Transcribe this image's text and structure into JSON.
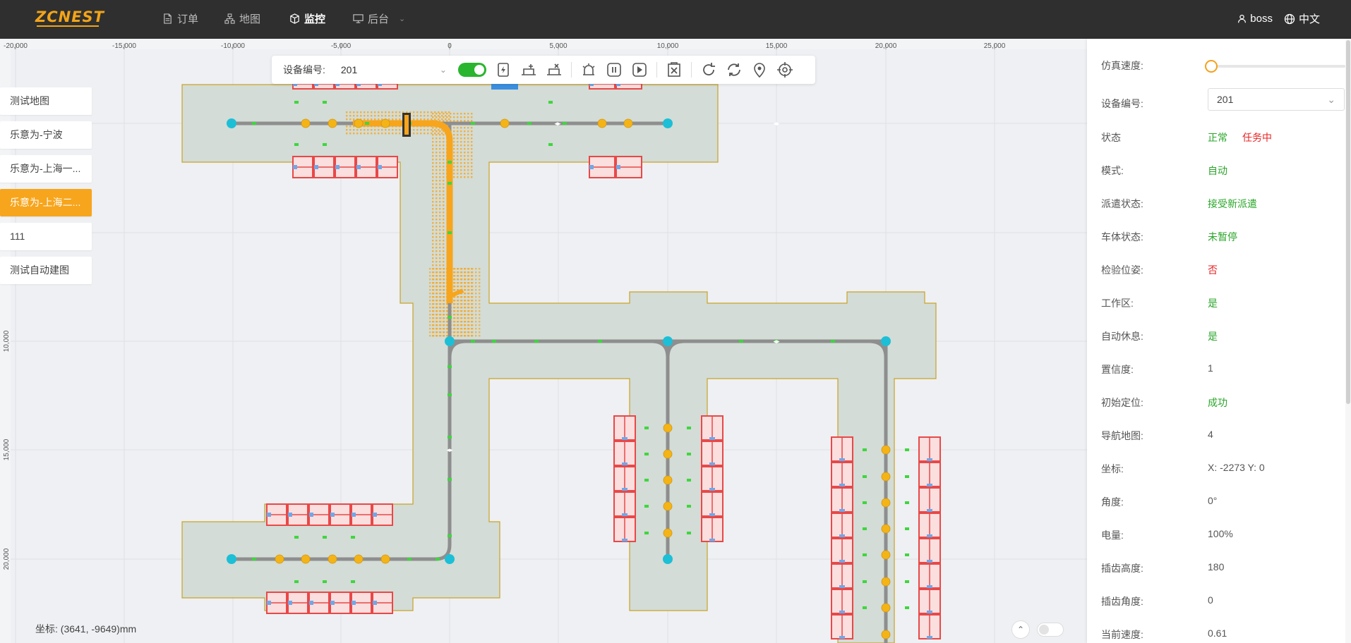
{
  "header": {
    "logo": "ZCNEST",
    "nav": [
      {
        "label": "订单",
        "icon": "document-icon"
      },
      {
        "label": "地图",
        "icon": "sitemap-icon"
      },
      {
        "label": "监控",
        "icon": "cube-icon",
        "active": true
      },
      {
        "label": "后台",
        "icon": "monitor-icon"
      }
    ],
    "user": "boss",
    "language": "中文"
  },
  "ruler": {
    "x_ticks": [
      "-20,000",
      "-15,000",
      "-10,000",
      "-5,000",
      "0",
      "5,000",
      "10,000",
      "15,000",
      "20,000",
      "25,000"
    ],
    "y_ticks": [
      "10,000",
      "15,000",
      "20,000"
    ]
  },
  "maps": [
    {
      "label": "测试地图",
      "active": false
    },
    {
      "label": "乐意为-宁波",
      "active": false
    },
    {
      "label": "乐意为-上海一...",
      "active": false
    },
    {
      "label": "乐意为-上海二...",
      "active": true
    },
    {
      "label": "111",
      "active": false
    },
    {
      "label": "测试自动建图",
      "active": false
    }
  ],
  "toolbar": {
    "device_label": "设备编号:",
    "device_value": "201",
    "toggle_on": true,
    "icons": [
      "charge-icon",
      "add-shelf-icon",
      "remove-shelf-icon",
      "alarm-icon",
      "pause-icon",
      "play-icon",
      "clear-task-icon",
      "reload-icon",
      "sync-icon",
      "location-pin-icon",
      "target-icon"
    ]
  },
  "coord_readout": "坐标:  (3641, -9649)mm",
  "panel": {
    "sim_speed_label": "仿真速度:",
    "sim_speed_value": 0,
    "device_label": "设备编号:",
    "device_value": "201",
    "rows": [
      {
        "label": "状态",
        "value": "正常",
        "value2": "任务中",
        "color": "green",
        "color2": "red"
      },
      {
        "label": "模式:",
        "value": "自动",
        "color": "green"
      },
      {
        "label": "派遣状态:",
        "value": "接受新派遣",
        "color": "green"
      },
      {
        "label": "车体状态:",
        "value": "未暂停",
        "color": "green"
      },
      {
        "label": "检验位姿:",
        "value": "否",
        "color": "red"
      },
      {
        "label": "工作区:",
        "value": "是",
        "color": "green"
      },
      {
        "label": "自动休息:",
        "value": "是",
        "color": "green"
      },
      {
        "label": "置信度:",
        "value": "1",
        "color": ""
      },
      {
        "label": "初始定位:",
        "value": "成功",
        "color": "green"
      },
      {
        "label": "导航地图:",
        "value": "4",
        "color": ""
      },
      {
        "label": "坐标:",
        "value": "X: -2273 Y: 0",
        "color": ""
      },
      {
        "label": "角度:",
        "value": "0°",
        "color": ""
      },
      {
        "label": "电量:",
        "value": "100%",
        "color": ""
      },
      {
        "label": "插齿高度:",
        "value": "180",
        "color": ""
      },
      {
        "label": "插齿角度:",
        "value": "0",
        "color": ""
      },
      {
        "label": "当前速度:",
        "value": "0.61",
        "color": ""
      }
    ]
  },
  "colors": {
    "accent": "#f7a51c",
    "floor": "#d3dcd6",
    "floor_border": "#c9a227",
    "shelf": "#e84848",
    "node": "#1cbfd6",
    "road": "#8e8e8e"
  }
}
